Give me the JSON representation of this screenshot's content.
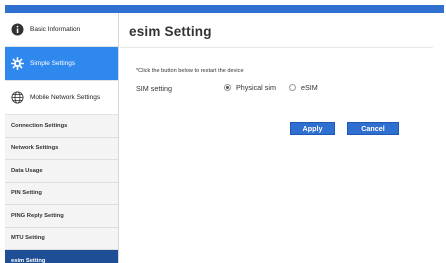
{
  "sidebar": {
    "main_items": [
      {
        "label": "Basic Information",
        "icon": "info-icon"
      },
      {
        "label": "Simple Settings",
        "icon": "gear-icon"
      },
      {
        "label": "Mobile Network Settings",
        "icon": "globe-icon"
      }
    ],
    "sub_items": [
      {
        "label": "Connection Settings"
      },
      {
        "label": "Network Settings"
      },
      {
        "label": "Data Usage"
      },
      {
        "label": "PIN Setting"
      },
      {
        "label": "PING Reply Setting"
      },
      {
        "label": "MTU Setting"
      },
      {
        "label": "esim Setting"
      }
    ]
  },
  "page": {
    "title": "esim Setting",
    "note": "*Click the button below to restart the device",
    "sim_label": "SIM setting",
    "options": [
      {
        "label": "Physical sim",
        "selected": true
      },
      {
        "label": "eSIM",
        "selected": false
      }
    ],
    "apply_label": "Apply",
    "cancel_label": "Cancel"
  },
  "colors": {
    "accent": "#2f88ee",
    "selected_sub": "#1e4f96",
    "button": "#2f6fd0"
  }
}
